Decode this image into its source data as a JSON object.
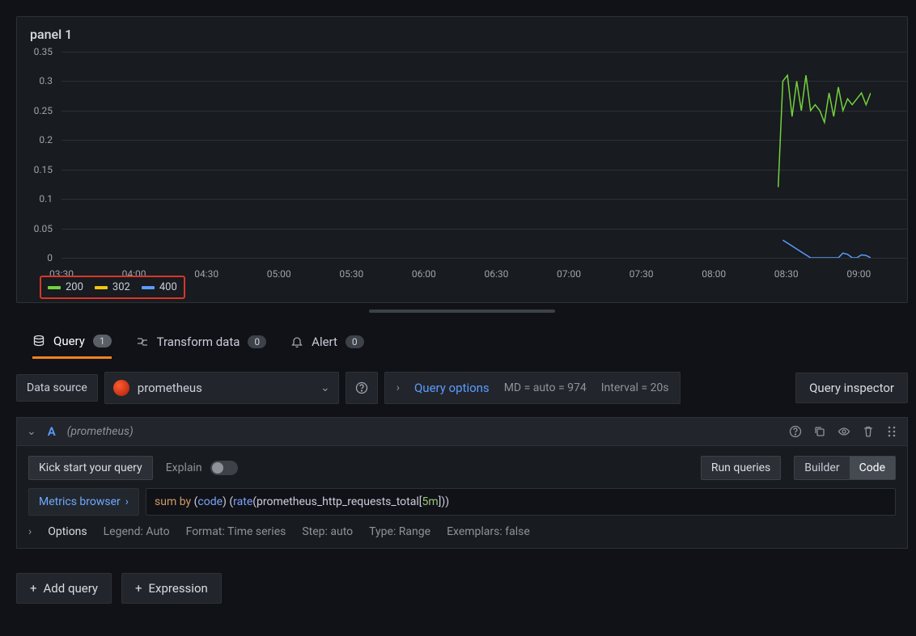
{
  "panel": {
    "title": "panel 1"
  },
  "chart_data": {
    "type": "line",
    "xlabel": "",
    "ylabel": "",
    "ylim": [
      0,
      0.35
    ],
    "yticks": [
      0,
      0.05,
      0.1,
      0.15,
      0.2,
      0.25,
      0.3,
      0.35
    ],
    "xticks": [
      "03:30",
      "04:00",
      "04:30",
      "05:00",
      "05:30",
      "06:00",
      "06:30",
      "07:00",
      "07:30",
      "08:00",
      "08:30",
      "09:00"
    ],
    "x_range_minutes": [
      210,
      560
    ],
    "series": [
      {
        "name": "200",
        "color": "#73d13d",
        "points": [
          [
            520,
            0.12
          ],
          [
            522,
            0.3
          ],
          [
            524,
            0.31
          ],
          [
            526,
            0.24
          ],
          [
            528,
            0.3
          ],
          [
            530,
            0.25
          ],
          [
            532,
            0.31
          ],
          [
            534,
            0.25
          ],
          [
            536,
            0.26
          ],
          [
            538,
            0.25
          ],
          [
            540,
            0.23
          ],
          [
            542,
            0.28
          ],
          [
            544,
            0.24
          ],
          [
            546,
            0.29
          ],
          [
            548,
            0.25
          ],
          [
            550,
            0.27
          ],
          [
            552,
            0.26
          ],
          [
            554,
            0.27
          ],
          [
            556,
            0.28
          ],
          [
            558,
            0.26
          ],
          [
            560,
            0.28
          ]
        ]
      },
      {
        "name": "302",
        "color": "#f1c40f",
        "points": []
      },
      {
        "name": "400",
        "color": "#5b9bff",
        "points": [
          [
            522,
            0.03
          ],
          [
            524,
            0.025
          ],
          [
            526,
            0.02
          ],
          [
            528,
            0.015
          ],
          [
            530,
            0.01
          ],
          [
            532,
            0.005
          ],
          [
            534,
            0
          ],
          [
            546,
            0
          ],
          [
            548,
            0.008
          ],
          [
            550,
            0.006
          ],
          [
            552,
            0
          ],
          [
            554,
            0
          ],
          [
            556,
            0.005
          ],
          [
            558,
            0.004
          ],
          [
            560,
            0
          ]
        ]
      }
    ]
  },
  "tabs": {
    "query": {
      "label": "Query",
      "count": "1"
    },
    "transform": {
      "label": "Transform data",
      "count": "0"
    },
    "alert": {
      "label": "Alert",
      "count": "0"
    }
  },
  "datasource": {
    "label": "Data source",
    "name": "prometheus"
  },
  "query_options": {
    "link": "Query options",
    "md": "MD = auto = 974",
    "interval": "Interval = 20s"
  },
  "inspector_btn": "Query inspector",
  "query_row": {
    "letter": "A",
    "ds": "(prometheus)",
    "kickstart": "Kick start your query",
    "explain": "Explain",
    "run": "Run queries",
    "builder": "Builder",
    "code": "Code",
    "metrics_browser": "Metrics browser",
    "query_tokens": {
      "t1": "sum by ",
      "t2": "(",
      "t3": "code",
      "t4": ") (",
      "t5": "rate",
      "t6": "(",
      "t7": "prometheus_http_requests_total",
      "t8": "[",
      "t9": "5m",
      "t10": "]",
      "t11": "))"
    },
    "options": {
      "label": "Options",
      "legend": "Legend: Auto",
      "format": "Format: Time series",
      "step": "Step: auto",
      "type": "Type: Range",
      "exemplars": "Exemplars: false"
    }
  },
  "footer": {
    "add_query": "Add query",
    "expression": "Expression"
  }
}
